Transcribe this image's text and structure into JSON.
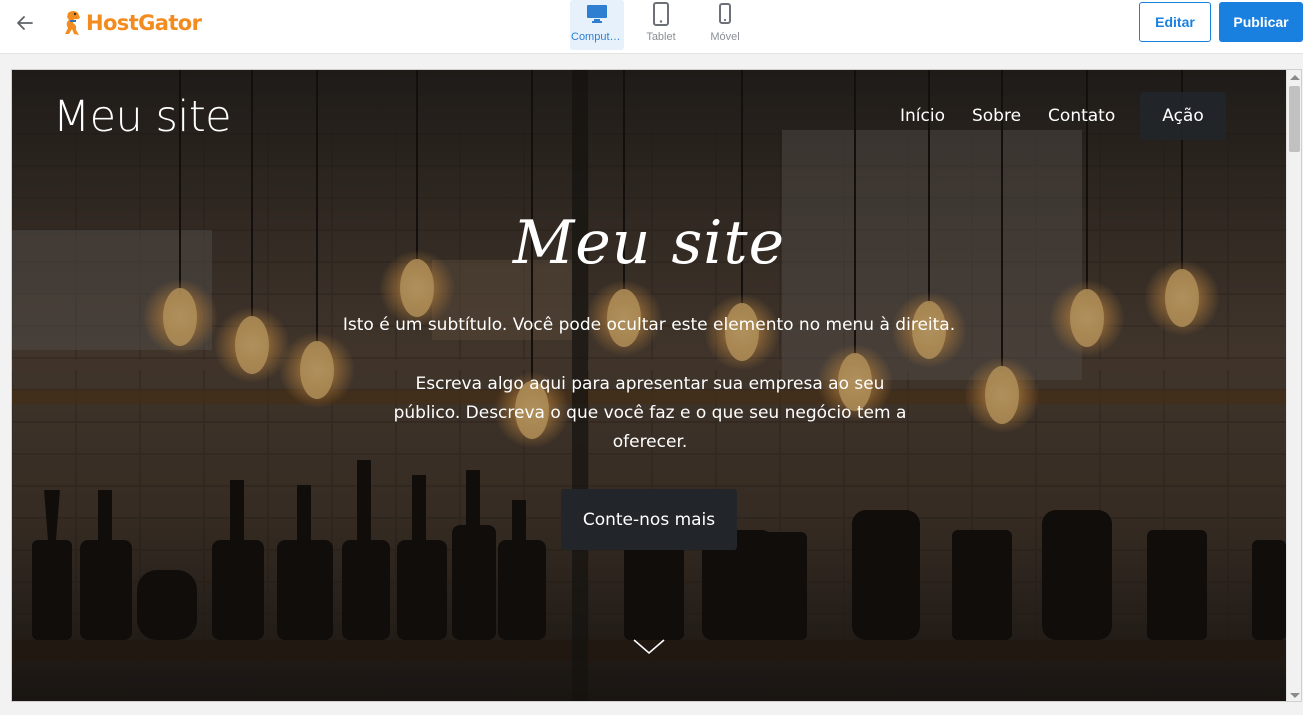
{
  "editor": {
    "brand": "HostGator",
    "devices": [
      {
        "label": "Computador",
        "icon": "desktop-icon",
        "active": true
      },
      {
        "label": "Tablet",
        "icon": "tablet-icon",
        "active": false
      },
      {
        "label": "Móvel",
        "icon": "mobile-icon",
        "active": false
      }
    ],
    "edit_label": "Editar",
    "publish_label": "Publicar",
    "accent": "#1a80e0",
    "brand_color": "#f28c1e"
  },
  "site": {
    "title": "Meu site",
    "nav": [
      "Início",
      "Sobre",
      "Contato"
    ],
    "nav_cta": "Ação",
    "hero": {
      "title": "Meu site",
      "subtitle": "Isto é um subtítulo. Você pode ocultar este elemento no menu à direita.",
      "description": "Escreva algo aqui para apresentar sua empresa ao seu público. Descreva o que você faz e o que seu negócio tem a oferecer.",
      "button": "Conte-nos mais"
    }
  }
}
